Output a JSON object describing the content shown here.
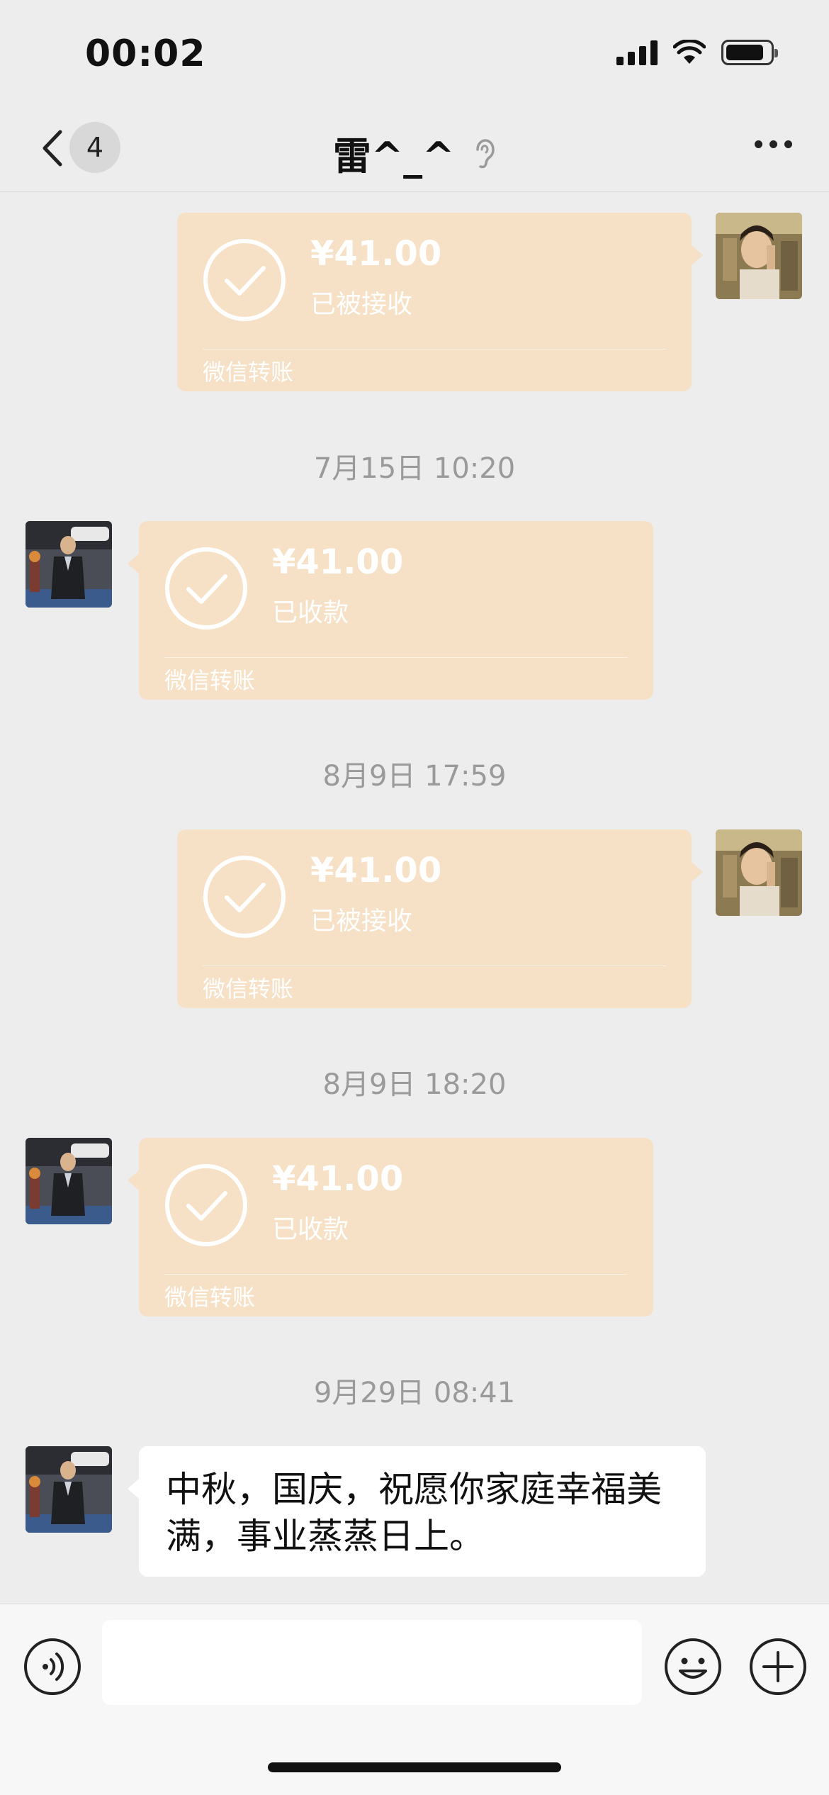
{
  "status_bar": {
    "time": "00:02"
  },
  "nav": {
    "unread_count": "4",
    "title": "雷^_^"
  },
  "messages": [
    {
      "type": "transfer",
      "side": "right",
      "amount": "¥41.00",
      "state": "已被接收",
      "footer": "微信转账"
    },
    {
      "type": "timestamp",
      "text": "7月15日 10:20"
    },
    {
      "type": "transfer",
      "side": "left",
      "amount": "¥41.00",
      "state": "已收款",
      "footer": "微信转账"
    },
    {
      "type": "timestamp",
      "text": "8月9日 17:59"
    },
    {
      "type": "transfer",
      "side": "right",
      "amount": "¥41.00",
      "state": "已被接收",
      "footer": "微信转账"
    },
    {
      "type": "timestamp",
      "text": "8月9日 18:20"
    },
    {
      "type": "transfer",
      "side": "left",
      "amount": "¥41.00",
      "state": "已收款",
      "footer": "微信转账"
    },
    {
      "type": "timestamp",
      "text": "9月29日 08:41"
    },
    {
      "type": "text",
      "side": "left",
      "lines": [
        "中秋，国庆，祝愿你家庭幸福美",
        "满，事业蒸蒸日上。"
      ]
    }
  ],
  "input_bar": {
    "message_value": ""
  },
  "colors": {
    "transfer_bubble": "#f7e1c6",
    "background": "#ededed",
    "text_bubble": "#ffffff"
  },
  "icons": {
    "back": "chevron-left-icon",
    "ear": "ear-icon",
    "more": "more-dots-icon",
    "voice": "voice-icon",
    "emoji": "emoji-icon",
    "plus": "plus-icon"
  }
}
